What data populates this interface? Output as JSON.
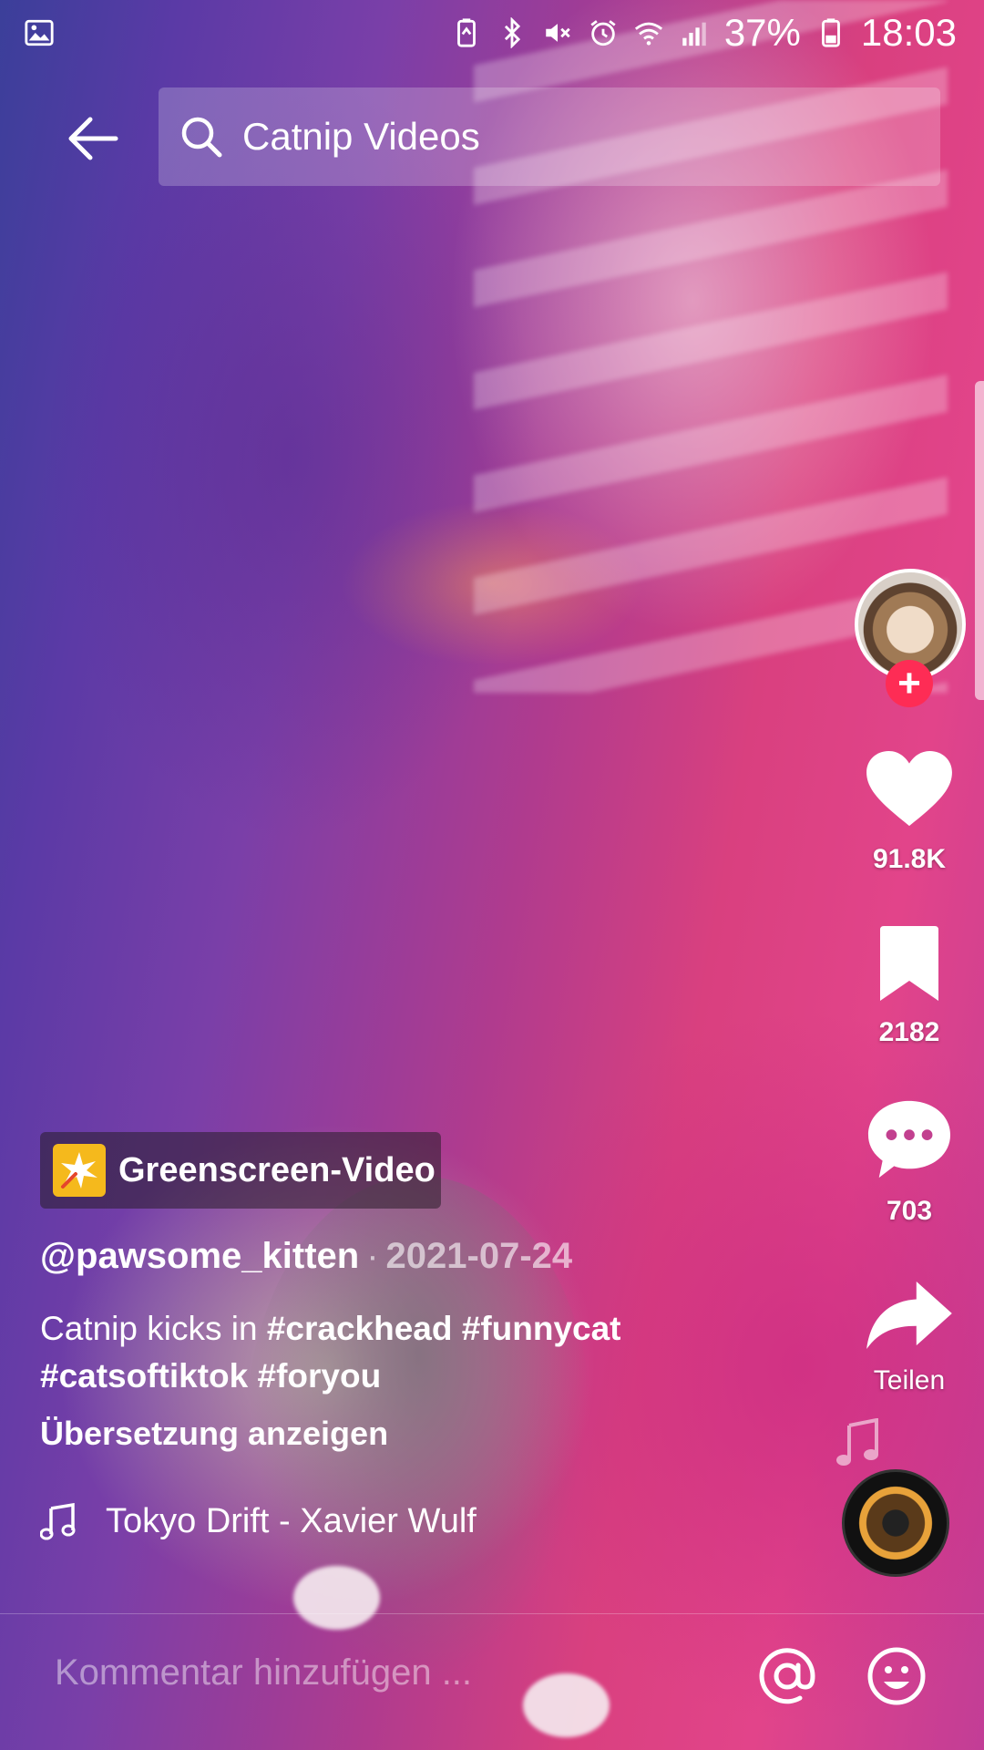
{
  "status_bar": {
    "battery": "37%",
    "time": "18:03",
    "icons": [
      "gallery-icon",
      "battery-saver-icon",
      "bluetooth-icon",
      "mute-icon",
      "alarm-icon",
      "wifi-icon",
      "signal-icon",
      "battery-icon"
    ]
  },
  "search": {
    "query": "Catnip Videos",
    "back_icon": "arrow-left-icon",
    "search_icon": "search-icon"
  },
  "actions": {
    "likes": "91.8K",
    "bookmarks": "2182",
    "comments": "703",
    "share_label": "Teilen"
  },
  "effect": {
    "label": "Greenscreen-Video",
    "icon": "sparkle-icon"
  },
  "video": {
    "author": "@pawsome_kitten",
    "separator": "·",
    "date": "2021-07-24",
    "description_text": "Catnip kicks in",
    "hashtags": [
      "#crackhead",
      "#funnycat",
      "#catsoftiktok",
      "#foryou"
    ],
    "translate_label": "Übersetzung anzeigen",
    "music": "Tokyo Drift - Xavier Wulf"
  },
  "comment_bar": {
    "placeholder": "Kommentar hinzufügen ..."
  },
  "colors": {
    "accent": "#fe2c55",
    "effect_yellow": "#f5b91c"
  }
}
